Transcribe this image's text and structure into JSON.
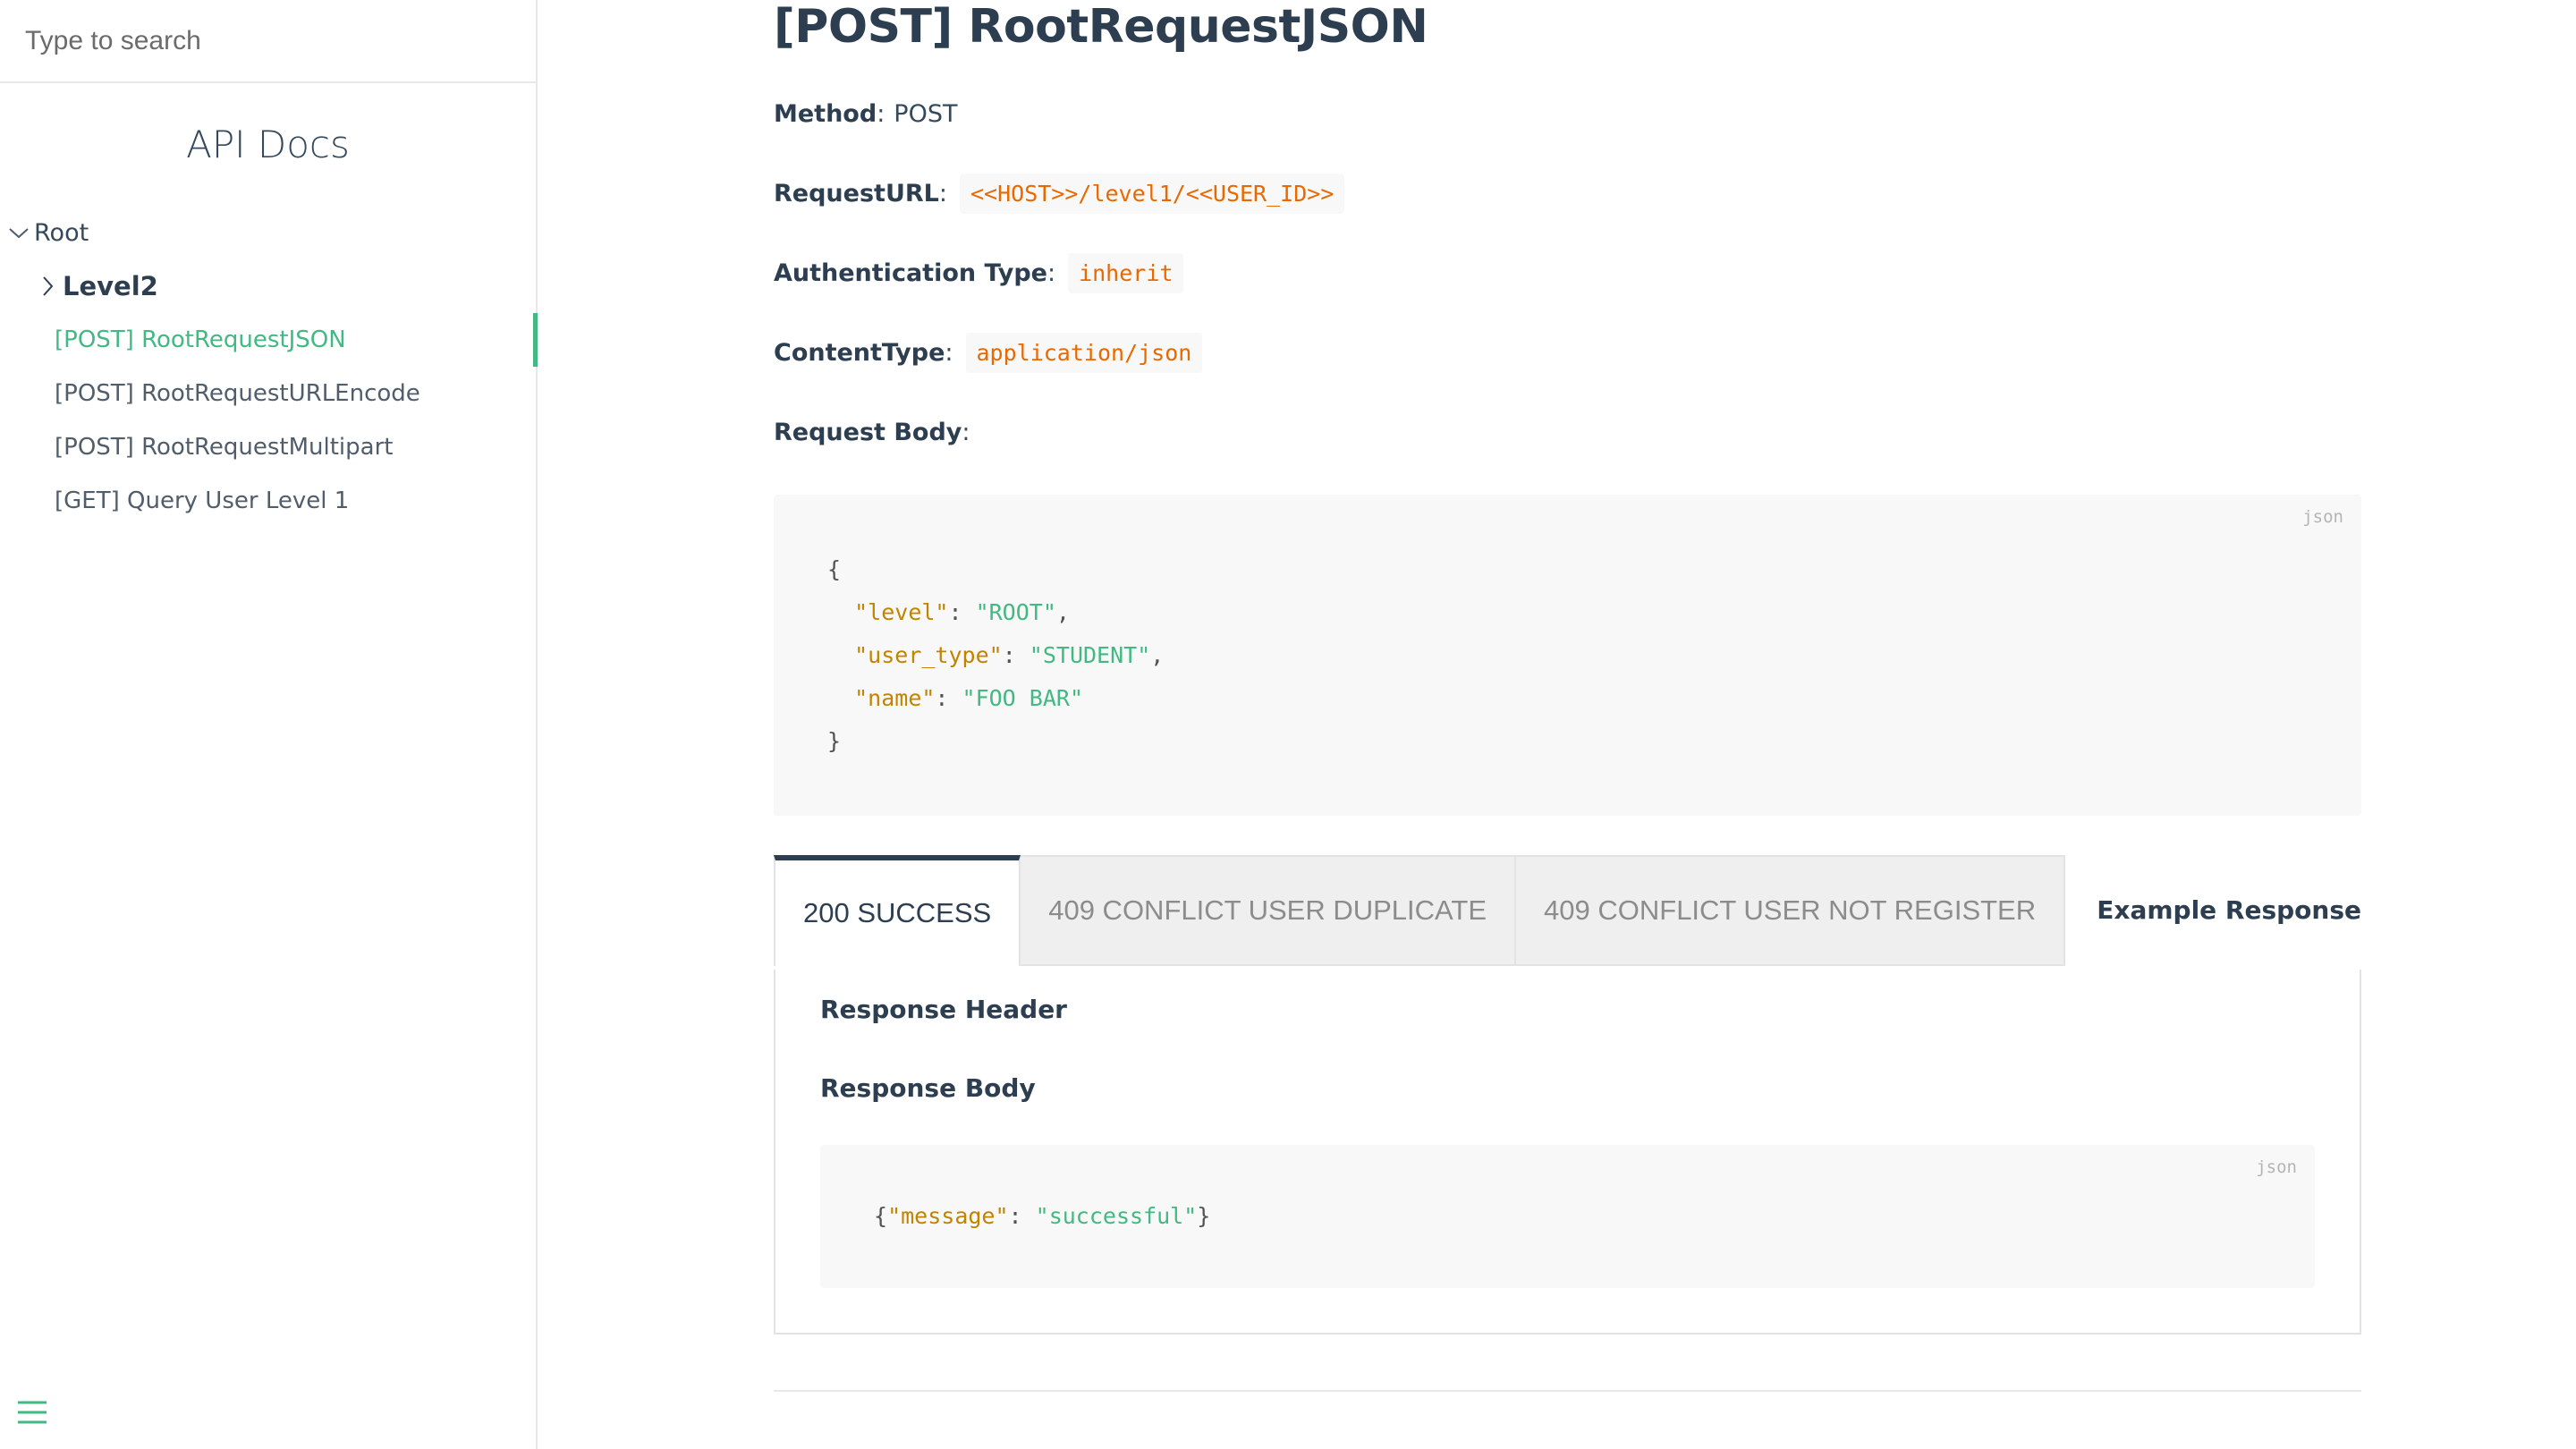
{
  "sidebar": {
    "search_placeholder": "Type to search",
    "app_name": "API Docs",
    "root_label": "Root",
    "level2_label": "Level2",
    "items": [
      {
        "label": "[POST] RootRequestJSON",
        "active": true
      },
      {
        "label": "[POST] RootRequestURLEncode",
        "active": false
      },
      {
        "label": "[POST] RootRequestMultipart",
        "active": false
      },
      {
        "label": "[GET] Query User Level 1",
        "active": false
      }
    ]
  },
  "main": {
    "title": "[POST] RootRequestJSON",
    "method_label": "Method",
    "method_value": "POST",
    "request_url_label": "RequestURL",
    "request_url_value": "<<HOST>>/level1/<<USER_ID>>",
    "auth_label": "Authentication Type",
    "auth_value": "inherit",
    "content_type_label": "ContentType",
    "content_type_value": "application/json",
    "request_body_label": "Request Body",
    "request_body": {
      "lang": "json",
      "open": "{",
      "close": "}",
      "fields": [
        {
          "key": "\"level\"",
          "value": "\"ROOT\"",
          "trail": ","
        },
        {
          "key": "\"user_type\"",
          "value": "\"STUDENT\"",
          "trail": ","
        },
        {
          "key": "\"name\"",
          "value": "\"FOO BAR\"",
          "trail": ""
        }
      ]
    },
    "tabs": [
      {
        "label": "200 SUCCESS",
        "active": true
      },
      {
        "label": "409 CONFLICT USER DUPLICATE",
        "active": false
      },
      {
        "label": "409 CONFLICT USER NOT REGISTER",
        "active": false
      }
    ],
    "example_response_label": "Example Response",
    "response_header_label": "Response Header",
    "response_body_label": "Response Body",
    "response_body": {
      "lang": "json",
      "open": "{",
      "key": "\"message\"",
      "value": "\"successful\"",
      "close": "}"
    }
  }
}
